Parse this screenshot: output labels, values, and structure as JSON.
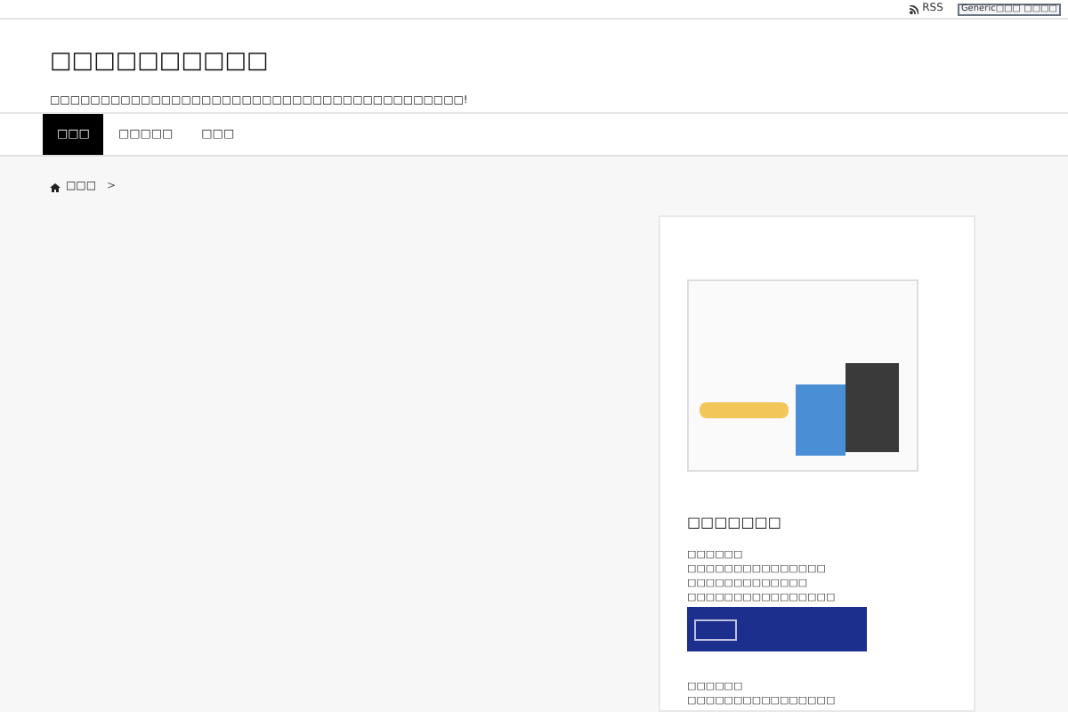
{
  "topbar": {
    "rss": "RSS",
    "badge": "Generic□□□ □□□□"
  },
  "site": {
    "title": "□□□□□□□□□□",
    "tagline": "□□□□□□□□□□□□□□□□□□□□□□□□□□□□□□□□□□□□□□□□□!"
  },
  "nav": [
    {
      "label": "□□□",
      "selected": true
    },
    {
      "label": "□□□□□",
      "selected": false
    },
    {
      "label": "□□□",
      "selected": false
    }
  ],
  "breadcrumb": {
    "home": "□□□",
    "separator": ">"
  },
  "sidebar": {
    "heading": "□□□□□□□",
    "blocks": [
      {
        "lines": [
          "□□□□□□",
          "□□□□□□□□□□□□□□□",
          "□□□□□□□□□□□□□",
          "□□□□□□□□□□□□□□□□"
        ],
        "banner": true
      },
      {
        "lines": [
          "□□□□□□",
          "□□□□□□□□□□□□□□□□"
        ],
        "banner": false
      }
    ]
  }
}
